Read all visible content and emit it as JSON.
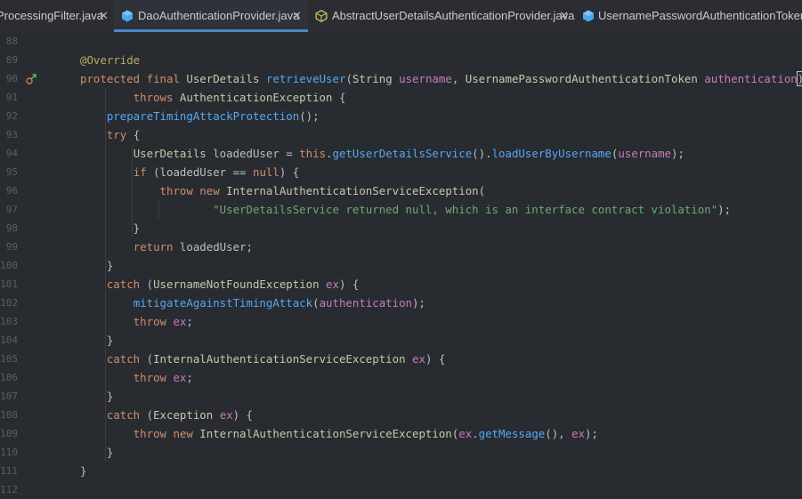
{
  "tabs": [
    {
      "label": "ProcessingFilter.java",
      "icon": "none",
      "active": false
    },
    {
      "label": "DaoAuthenticationProvider.java",
      "icon": "class-icon",
      "active": true
    },
    {
      "label": "AbstractUserDetailsAuthenticationProvider.java",
      "icon": "abstract-class-icon",
      "active": false
    },
    {
      "label": "UsernamePasswordAuthenticationToken.java",
      "icon": "class-icon",
      "active": false
    }
  ],
  "close_glyph": "✕",
  "colors": {
    "background": "#282b30",
    "keyword": "#cf8e6d",
    "annotation": "#b3ae60",
    "method": "#56a8f5",
    "parameter": "#c77dbb",
    "string": "#6aab73",
    "tab_underline": "#4a88c7"
  },
  "lines": [
    {
      "n": "88",
      "segs": []
    },
    {
      "n": "89",
      "segs": [
        [
          "a",
          "@Override"
        ]
      ]
    },
    {
      "n": "90",
      "icon": "override-icon",
      "segs": [
        [
          "k",
          "protected "
        ],
        [
          "k",
          "final "
        ],
        [
          "t",
          "UserDetails "
        ],
        [
          "m",
          "retrieveUser"
        ],
        [
          "v",
          "("
        ],
        [
          "t",
          "String "
        ],
        [
          "p",
          "username"
        ],
        [
          "v",
          ", "
        ],
        [
          "t",
          "UsernamePasswordAuthenticationToken "
        ],
        [
          "p",
          "authentication"
        ],
        [
          "v",
          ")"
        ]
      ]
    },
    {
      "n": "91",
      "segs": [
        [
          "v",
          "        "
        ],
        [
          "k",
          "throws "
        ],
        [
          "t",
          "AuthenticationException "
        ],
        [
          "v",
          "{"
        ]
      ]
    },
    {
      "n": "92",
      "segs": [
        [
          "v",
          "    "
        ],
        [
          "m",
          "prepareTimingAttackProtection"
        ],
        [
          "v",
          "();"
        ]
      ]
    },
    {
      "n": "93",
      "segs": [
        [
          "v",
          "    "
        ],
        [
          "k",
          "try "
        ],
        [
          "v",
          "{"
        ]
      ]
    },
    {
      "n": "94",
      "segs": [
        [
          "v",
          "        "
        ],
        [
          "t",
          "UserDetails "
        ],
        [
          "v",
          "loadedUser = "
        ],
        [
          "k",
          "this"
        ],
        [
          "v",
          "."
        ],
        [
          "m",
          "getUserDetailsService"
        ],
        [
          "v",
          "()."
        ],
        [
          "m",
          "loadUserByUsername"
        ],
        [
          "v",
          "("
        ],
        [
          "p",
          "username"
        ],
        [
          "v",
          ");"
        ]
      ]
    },
    {
      "n": "95",
      "segs": [
        [
          "v",
          "        "
        ],
        [
          "k",
          "if "
        ],
        [
          "v",
          "(loadedUser == "
        ],
        [
          "k",
          "null"
        ],
        [
          "v",
          ") {"
        ]
      ]
    },
    {
      "n": "96",
      "segs": [
        [
          "v",
          "            "
        ],
        [
          "k",
          "throw "
        ],
        [
          "k",
          "new "
        ],
        [
          "t",
          "InternalAuthenticationServiceException"
        ],
        [
          "v",
          "("
        ]
      ]
    },
    {
      "n": "97",
      "segs": [
        [
          "v",
          "                    "
        ],
        [
          "s",
          "\"UserDetailsService returned null, which is an interface contract violation\""
        ],
        [
          "v",
          ");"
        ]
      ]
    },
    {
      "n": "98",
      "segs": [
        [
          "v",
          "        }"
        ]
      ]
    },
    {
      "n": "99",
      "segs": [
        [
          "v",
          "        "
        ],
        [
          "k",
          "return "
        ],
        [
          "v",
          "loadedUser;"
        ]
      ]
    },
    {
      "n": "100",
      "segs": [
        [
          "v",
          "    }"
        ]
      ]
    },
    {
      "n": "101",
      "segs": [
        [
          "v",
          "    "
        ],
        [
          "k",
          "catch "
        ],
        [
          "v",
          "("
        ],
        [
          "t",
          "UsernameNotFoundException "
        ],
        [
          "p",
          "ex"
        ],
        [
          "v",
          ") {"
        ]
      ]
    },
    {
      "n": "102",
      "segs": [
        [
          "v",
          "        "
        ],
        [
          "m",
          "mitigateAgainstTimingAttack"
        ],
        [
          "v",
          "("
        ],
        [
          "p",
          "authentication"
        ],
        [
          "v",
          ");"
        ]
      ]
    },
    {
      "n": "103",
      "segs": [
        [
          "v",
          "        "
        ],
        [
          "k",
          "throw "
        ],
        [
          "p",
          "ex"
        ],
        [
          "v",
          ";"
        ]
      ]
    },
    {
      "n": "104",
      "segs": [
        [
          "v",
          "    }"
        ]
      ]
    },
    {
      "n": "105",
      "segs": [
        [
          "v",
          "    "
        ],
        [
          "k",
          "catch "
        ],
        [
          "v",
          "("
        ],
        [
          "t",
          "InternalAuthenticationServiceException "
        ],
        [
          "p",
          "ex"
        ],
        [
          "v",
          ") {"
        ]
      ]
    },
    {
      "n": "106",
      "segs": [
        [
          "v",
          "        "
        ],
        [
          "k",
          "throw "
        ],
        [
          "p",
          "ex"
        ],
        [
          "v",
          ";"
        ]
      ]
    },
    {
      "n": "107",
      "segs": [
        [
          "v",
          "    }"
        ]
      ]
    },
    {
      "n": "108",
      "segs": [
        [
          "v",
          "    "
        ],
        [
          "k",
          "catch "
        ],
        [
          "v",
          "("
        ],
        [
          "t",
          "Exception "
        ],
        [
          "p",
          "ex"
        ],
        [
          "v",
          ") {"
        ]
      ]
    },
    {
      "n": "109",
      "segs": [
        [
          "v",
          "        "
        ],
        [
          "k",
          "throw "
        ],
        [
          "k",
          "new "
        ],
        [
          "t",
          "InternalAuthenticationServiceException"
        ],
        [
          "v",
          "("
        ],
        [
          "p",
          "ex"
        ],
        [
          "v",
          "."
        ],
        [
          "m",
          "getMessage"
        ],
        [
          "v",
          "(), "
        ],
        [
          "p",
          "ex"
        ],
        [
          "v",
          ");"
        ]
      ]
    },
    {
      "n": "110",
      "segs": [
        [
          "v",
          "    }"
        ]
      ]
    },
    {
      "n": "111",
      "segs": [
        [
          "v",
          "}"
        ]
      ]
    },
    {
      "n": "112",
      "segs": []
    }
  ]
}
